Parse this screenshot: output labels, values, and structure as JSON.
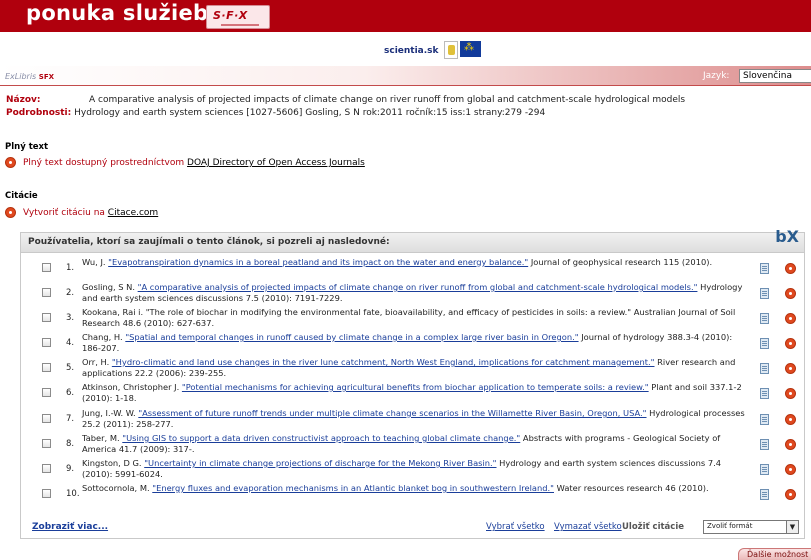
{
  "header": {
    "title": "ponuka služieb",
    "sfx_logo": "S·F·X",
    "scientia": "scientia.sk"
  },
  "bar": {
    "brand": "ExLibris",
    "brand_suffix": "SFX",
    "language_label": "Jazyk:",
    "language_value": "Slovenčina"
  },
  "meta": {
    "title_label": "Názov:",
    "title_value": "A comparative analysis of projected impacts of climate change on river runoff from global and catchment-scale hydrological models",
    "details_label": "Podrobnosti:",
    "details_value": "Hydrology and earth system sciences [1027-5606] Gosling, S N rok:2011 ročník:15 iss:1 strany:279 -294"
  },
  "fulltext": {
    "heading": "Plný text",
    "text": "Plný text dostupný prostredníctvom",
    "link": "DOAJ Directory of Open Access Journals"
  },
  "citations": {
    "heading": "Citácie",
    "text": "Vytvoriť citáciu na",
    "link": "Citace.com"
  },
  "related": {
    "heading": "Používatelia, ktorí sa zaujímali o tento článok, si pozreli aj nasledovné:",
    "bx": "bX",
    "items": [
      {
        "num": "1.",
        "author": "Wu, J.",
        "title": "\"Evapotranspiration dynamics in a boreal peatland and its impact on the water and energy balance.\"",
        "rest": "Journal of geophysical research 115 (2010)."
      },
      {
        "num": "2.",
        "author": "Gosling, S N.",
        "title": "\"A comparative analysis of projected impacts of climate change on river runoff from global and catchment-scale hydrological models.\"",
        "rest": "Hydrology and earth system sciences discussions 7.5 (2010): 7191-7229."
      },
      {
        "num": "3.",
        "author": "Kookana, Rai i.",
        "title": "",
        "rest": "\"The role of biochar in modifying the environmental fate, bioavailability, and efficacy of pesticides in soils: a review.\" Australian Journal of Soil Research 48.6 (2010): 627-637."
      },
      {
        "num": "4.",
        "author": "Chang, H.",
        "title": "\"Spatial and temporal changes in runoff caused by climate change in a complex large river basin in Oregon.\"",
        "rest": "Journal of hydrology 388.3-4 (2010): 186-207."
      },
      {
        "num": "5.",
        "author": "Orr, H.",
        "title": "\"Hydro-climatic and land use changes in the river lune catchment, North West England, implications for catchment management.\"",
        "rest": "River research and applications 22.2 (2006): 239-255."
      },
      {
        "num": "6.",
        "author": "Atkinson, Christopher J.",
        "title": "\"Potential mechanisms for achieving agricultural benefits from biochar application to temperate soils: a review.\"",
        "rest": "Plant and soil 337.1-2 (2010): 1-18."
      },
      {
        "num": "7.",
        "author": "Jung, I.-W. W.",
        "title": "\"Assessment of future runoff trends under multiple climate change scenarios in the Willamette River Basin, Oregon, USA.\"",
        "rest": "Hydrological processes 25.2 (2011): 258-277."
      },
      {
        "num": "8.",
        "author": "Taber, M.",
        "title": "\"Using GIS to support a data driven constructivist approach to teaching global climate change.\"",
        "rest": "Abstracts with programs - Geological Society of America 41.7 (2009): 317-."
      },
      {
        "num": "9.",
        "author": "Kingston, D G.",
        "title": "\"Uncertainty in climate change projections of discharge for the Mekong River Basin.\"",
        "rest": "Hydrology and earth system sciences discussions 7.4 (2010): 5991-6024."
      },
      {
        "num": "10.",
        "author": "Sottocornola, M.",
        "title": "\"Energy fluxes and evaporation mechanisms in an Atlantic blanket bog in southwestern Ireland.\"",
        "rest": "Water resources research 46 (2010)."
      }
    ],
    "show_more": "Zobraziť viac...",
    "select_all": "Vybrať všetko",
    "delete_all": "Vymazať všetko",
    "save_label": "Uložiť citácie",
    "format_value": "Zvoliť formát",
    "more_options": "Ďalšie možnost"
  }
}
